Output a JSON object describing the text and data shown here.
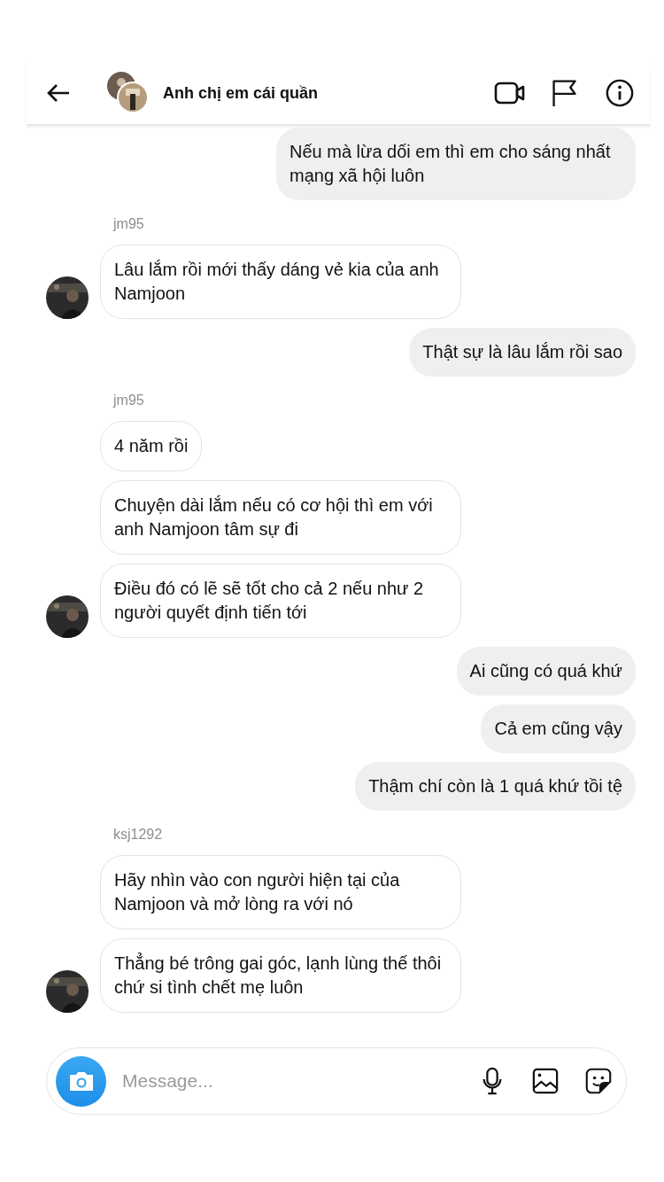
{
  "header": {
    "title": "Anh chị em cái quần"
  },
  "messages": [
    {
      "kind": "sent",
      "text": "Nếu mà lừa dối em thì em cho sáng nhất mạng xã hội luôn"
    },
    {
      "kind": "sender",
      "text": "jm95"
    },
    {
      "kind": "received",
      "text": "Lâu lắm rồi mới thấy dáng vẻ kia của anh Namjoon",
      "avatar": true
    },
    {
      "kind": "sent",
      "text": "Thật sự là lâu lắm rồi sao"
    },
    {
      "kind": "sender",
      "text": "jm95"
    },
    {
      "kind": "received",
      "text": "4 năm rồi",
      "avatar": false
    },
    {
      "kind": "received",
      "text": "Chuyện dài lắm nếu có cơ hội thì em với anh Namjoon tâm sự đi",
      "avatar": false
    },
    {
      "kind": "received",
      "text": "Điều đó có lẽ sẽ tốt cho cả 2 nếu như 2 người quyết định tiến tới",
      "avatar": true
    },
    {
      "kind": "sent",
      "text": "Ai cũng có quá khứ"
    },
    {
      "kind": "sent",
      "text": "Cả em cũng vậy"
    },
    {
      "kind": "sent",
      "text": "Thậm chí còn là 1 quá khứ tồi tệ"
    },
    {
      "kind": "sender",
      "text": "ksj1292"
    },
    {
      "kind": "received",
      "text": "Hãy nhìn vào con người hiện tại của Namjoon và mở lòng ra với nó",
      "avatar": false
    },
    {
      "kind": "received",
      "text": "Thẳng bé trông gai góc, lạnh lùng thế thôi chứ si tình chết mẹ luôn",
      "avatar": true
    }
  ],
  "composer": {
    "placeholder": "Message..."
  }
}
